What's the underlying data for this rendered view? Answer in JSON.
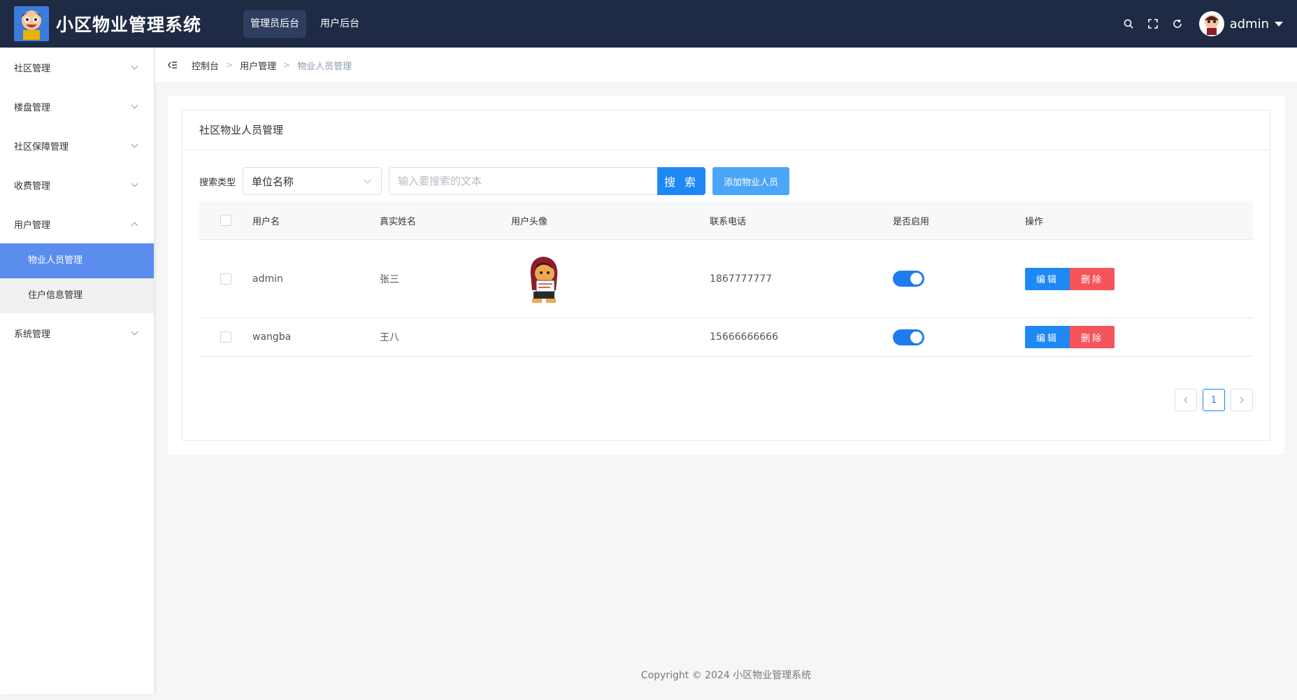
{
  "header": {
    "app_title": "小区物业管理系统",
    "tabs": [
      {
        "label": "管理员后台"
      },
      {
        "label": "用户后台"
      }
    ],
    "user": {
      "name": "admin"
    }
  },
  "sidebar": {
    "items": [
      {
        "label": "社区管理"
      },
      {
        "label": "楼盘管理"
      },
      {
        "label": "社区保障管理"
      },
      {
        "label": "收费管理"
      },
      {
        "label": "用户管理"
      },
      {
        "label": "系统管理"
      }
    ],
    "submenu": [
      {
        "label": "物业人员管理"
      },
      {
        "label": "住户信息管理"
      }
    ]
  },
  "breadcrumb": {
    "items": [
      "控制台",
      "用户管理",
      "物业人员管理"
    ]
  },
  "panel": {
    "title": "社区物业人员管理",
    "search_label": "搜索类型",
    "search_type": "单位名称",
    "search_placeholder": "输入要搜索的文本",
    "search_button": "搜 索",
    "add_button": "添加物业人员"
  },
  "table": {
    "columns": [
      "用户名",
      "真实姓名",
      "用户头像",
      "联系电话",
      "是否启用",
      "操作"
    ],
    "rows": [
      {
        "username": "admin",
        "real_name": "张三",
        "phone": "1867777777",
        "enabled": true,
        "has_avatar": true
      },
      {
        "username": "wangba",
        "real_name": "王八",
        "phone": "15666666666",
        "enabled": true,
        "has_avatar": false
      }
    ],
    "edit_label": "编辑",
    "delete_label": "删除"
  },
  "pagination": {
    "current_page": "1"
  },
  "footer": {
    "copyright": "Copyright © 2024 小区物业管理系统"
  },
  "colors": {
    "header_bg": "#1f2a44",
    "primary": "#1e88f5",
    "danger": "#f5555a",
    "active_menu": "#5b8def"
  }
}
